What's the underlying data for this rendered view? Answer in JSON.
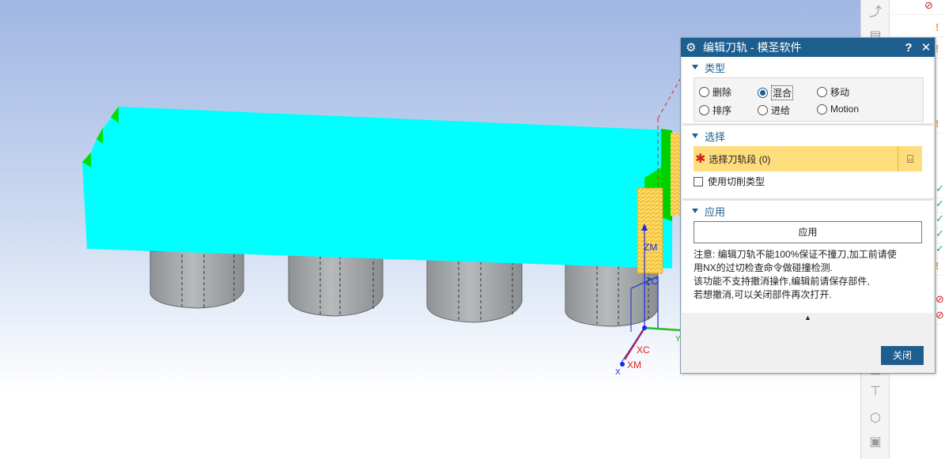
{
  "viewport": {
    "axis_labels": {
      "zm": "ZM",
      "zc": "ZC",
      "xc": "XC",
      "xm": "XM",
      "x": "X",
      "y": "Y"
    }
  },
  "dialog": {
    "title": "编辑刀轨 - 模圣软件",
    "help_label": "?",
    "close_label": "✕",
    "type_group": {
      "title": "类型",
      "options": [
        "删除",
        "混合",
        "移动",
        "排序",
        "进给",
        "Motion"
      ],
      "selected": "混合"
    },
    "select_group": {
      "title": "选择",
      "select_label": "选择刀轨段 (0)",
      "checkbox_label": "使用切削类型"
    },
    "apply_group": {
      "title": "应用",
      "apply_button": "应用",
      "note_lines": [
        "注意: 编辑刀轨不能100%保证不撞刀,加工前请使",
        "用NX的过切检查命令做碰撞检测.",
        "该功能不支持撤消操作,编辑前请保存部件,",
        "若想撤消,可以关闭部件再次打开."
      ]
    },
    "close_button": "关闭"
  },
  "colors": {
    "accent": "#1d5e8f",
    "selection_bg": "#fedd7d",
    "part_top": "#00ffff",
    "cylinder": "#a7abad"
  }
}
